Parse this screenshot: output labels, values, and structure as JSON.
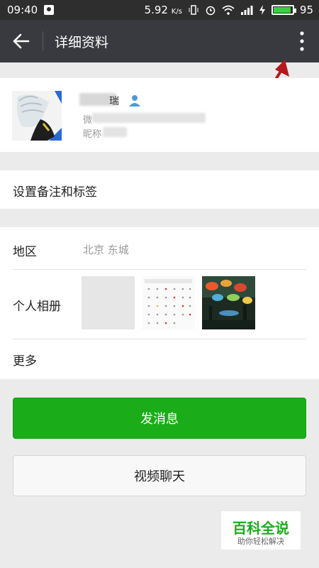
{
  "status_bar": {
    "time": "09:40",
    "network_speed": "5.92",
    "network_unit": "K/s",
    "battery_level": "95",
    "battery_fraction": 0.95
  },
  "header": {
    "title": "详细资料",
    "back_icon": "back-arrow-icon",
    "more_icon": "more-vertical-icon"
  },
  "profile": {
    "name_visible_char": "瑞",
    "wechat_id_prefix": "微",
    "nickname_prefix": "昵称"
  },
  "menu": {
    "remark_tags": "设置备注和标签",
    "region_label": "地区",
    "region_value": "北京  东城",
    "album_label": "个人相册",
    "more_label": "更多"
  },
  "actions": {
    "send_message": "发消息",
    "video_chat": "视频聊天"
  },
  "watermark": {
    "title": "百科全说",
    "subtitle": "助你轻松解决"
  },
  "colors": {
    "primary_green": "#1aad19",
    "titlebar": "#393a3f",
    "annotation_arrow": "#b3191e"
  }
}
